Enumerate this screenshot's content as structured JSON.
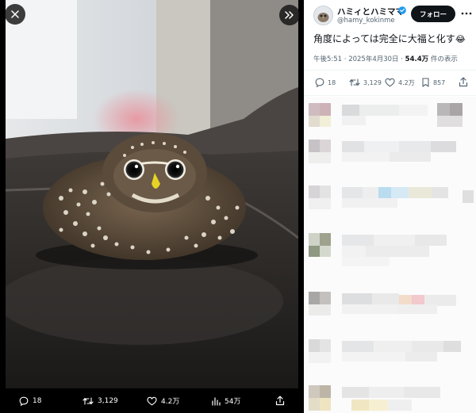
{
  "viewer": {
    "stats": [
      {
        "icon": "reply-icon",
        "value": "18"
      },
      {
        "icon": "retweet-icon",
        "value": "3,129"
      },
      {
        "icon": "heart-icon",
        "value": "4.2万"
      },
      {
        "icon": "views-icon",
        "value": "54万"
      },
      {
        "icon": "share-icon",
        "value": ""
      }
    ]
  },
  "author": {
    "name": "ハミィとハミママ",
    "handle": "@hamy_kokinme"
  },
  "follow_label": "フォロー",
  "post": {
    "text": "角度によっては完全に大福と化す",
    "emoji": "😂",
    "time": "午後5:51 · 2025年4月30日 · ",
    "views": "54.4万",
    "views_suffix": " 件の表示"
  },
  "actions": {
    "replies": "18",
    "retweets": "3,129",
    "likes": "4.2万",
    "bookmarks": "857"
  },
  "colors": {
    "accent": "#1d9bf0",
    "text": "#0f1419",
    "muted": "#536471",
    "owl_beak": "#e7d325"
  }
}
